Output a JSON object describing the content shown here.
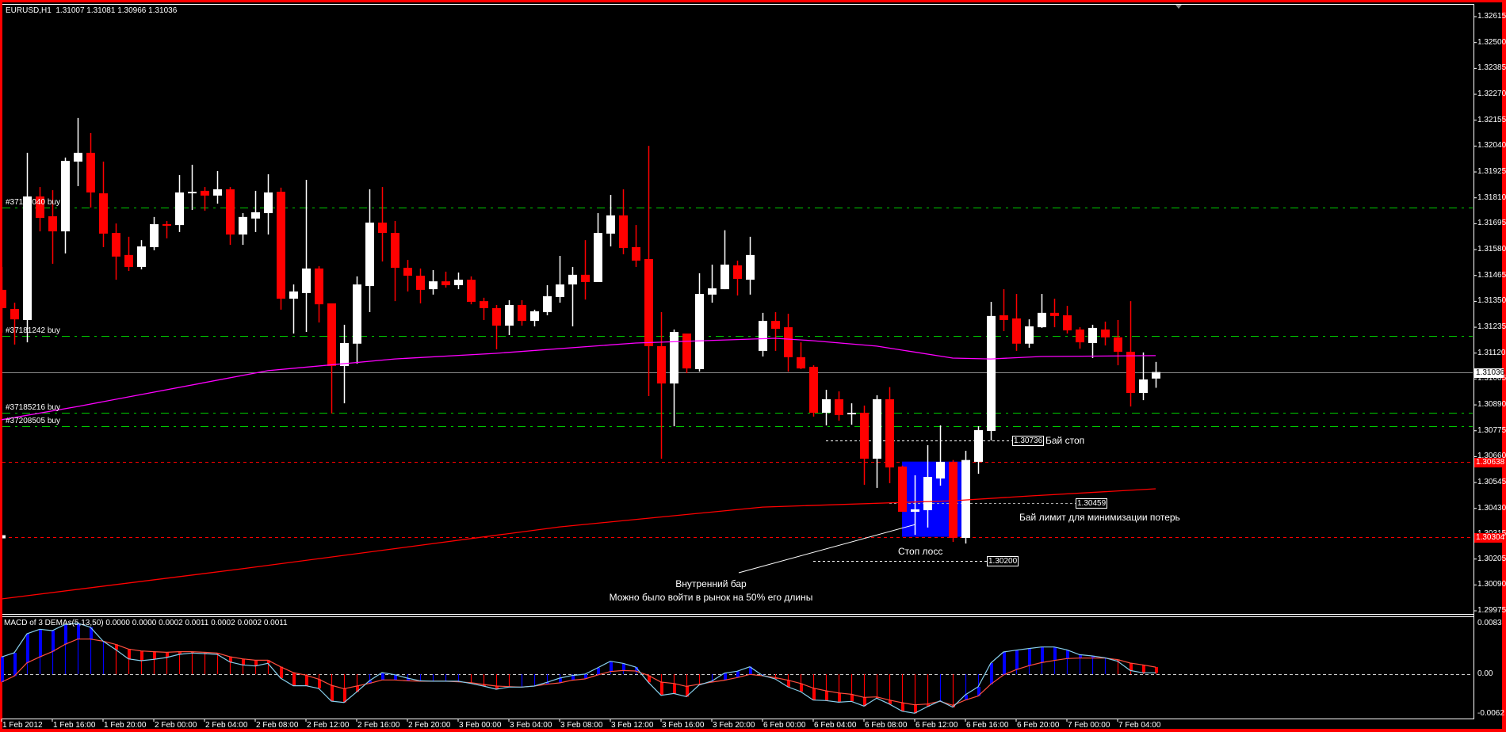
{
  "header": {
    "symbol": "EURUSD,H1",
    "ohlc": "1.31007 1.31081 1.30966 1.31036"
  },
  "colors": {
    "bull": "#ffffff",
    "bear": "#ff0000",
    "ma_fast": "#ff00ff",
    "ma_slow": "#ff0000",
    "grid_line": "#00cc00",
    "macd_main": "#87ceeb",
    "macd_signal": "#ff4f3f",
    "hist_up": "#0000ff",
    "hist_down": "#ff0000",
    "box": "#0000ff",
    "border": "#ff0000"
  },
  "orders": [
    {
      "label": "#37174040 buy",
      "price": 1.31767
    },
    {
      "label": "#37181242 buy",
      "price": 1.31196
    },
    {
      "label": "#37185216 buy",
      "price": 1.30855
    },
    {
      "label": "#37208505 buy",
      "price": 1.30795
    }
  ],
  "levels": {
    "upper": "1.30638",
    "lower": "1.30304",
    "current": "1.31036"
  },
  "annotations": {
    "buy_stop_price": "1.30736",
    "buy_stop_text": "Бай стоп",
    "buy_limit_price": "1.30459",
    "buy_limit_text": "Бай лимит для минимизации потерь",
    "stop_loss_price": "1.30200",
    "stop_loss_text": "Стоп лосс",
    "inside_bar_title": "Внутренний бар",
    "inside_bar_note": "Можно было войти в рынок на 50% его длины"
  },
  "macd": {
    "title": "MACD of 3 DEMAs(5,13,50) 0.0000 0.0000 0.0002 0.0011 0.0002 0.0002 0.0011",
    "axis": [
      "0.0083",
      "0.00",
      "-0.0062"
    ]
  },
  "chart_data": {
    "type": "candlestick",
    "title": "EURUSD,H1",
    "y_ticks": [
      "1.32615",
      "1.32500",
      "1.32385",
      "1.32270",
      "1.32155",
      "1.32040",
      "1.31925",
      "1.31810",
      "1.31695",
      "1.31580",
      "1.31465",
      "1.31350",
      "1.31235",
      "1.31120",
      "1.31005",
      "1.30890",
      "1.30775",
      "1.30660",
      "1.30545",
      "1.30430",
      "1.30315",
      "1.30205",
      "1.30090",
      "1.29975"
    ],
    "ylim": [
      1.29975,
      1.32615
    ],
    "x_labels": [
      "1 Feb 2012",
      "1 Feb 16:00",
      "1 Feb 20:00",
      "2 Feb 00:00",
      "2 Feb 04:00",
      "2 Feb 08:00",
      "2 Feb 12:00",
      "2 Feb 16:00",
      "2 Feb 20:00",
      "3 Feb 00:00",
      "3 Feb 04:00",
      "3 Feb 08:00",
      "3 Feb 12:00",
      "3 Feb 16:00",
      "3 Feb 20:00",
      "6 Feb 00:00",
      "6 Feb 04:00",
      "6 Feb 08:00",
      "6 Feb 12:00",
      "6 Feb 16:00",
      "6 Feb 20:00",
      "7 Feb 00:00",
      "7 Feb 04:00"
    ],
    "ohlc": [
      [
        1.31401,
        1.31503,
        1.31211,
        1.3132
      ],
      [
        1.31316,
        1.31344,
        1.31158,
        1.3127
      ],
      [
        1.31267,
        1.3201,
        1.31168,
        1.31816
      ],
      [
        1.31816,
        1.31858,
        1.31661,
        1.31721
      ],
      [
        1.31728,
        1.31844,
        1.31517,
        1.31661
      ],
      [
        1.31661,
        1.31989,
        1.31563,
        1.31974
      ],
      [
        1.31971,
        1.32165,
        1.31862,
        1.3201
      ],
      [
        1.3201,
        1.32098,
        1.31767,
        1.31834
      ],
      [
        1.3183,
        1.31971,
        1.31591,
        1.31651
      ],
      [
        1.31654,
        1.31696,
        1.31446,
        1.31549
      ],
      [
        1.31556,
        1.31637,
        1.31485,
        1.31503
      ],
      [
        1.31503,
        1.31622,
        1.31492,
        1.31594
      ],
      [
        1.31591,
        1.31725,
        1.31577,
        1.31693
      ],
      [
        1.31693,
        1.31707,
        1.3163,
        1.31689
      ],
      [
        1.31689,
        1.31911,
        1.31658,
        1.31834
      ],
      [
        1.3183,
        1.31957,
        1.31756,
        1.31837
      ],
      [
        1.31841,
        1.31858,
        1.31753,
        1.3182
      ],
      [
        1.3182,
        1.31929,
        1.31784,
        1.31848
      ],
      [
        1.31848,
        1.31858,
        1.31601,
        1.31647
      ],
      [
        1.31647,
        1.31742,
        1.31601,
        1.31725
      ],
      [
        1.31718,
        1.31841,
        1.31658,
        1.31746
      ],
      [
        1.31742,
        1.31915,
        1.31647,
        1.31834
      ],
      [
        1.31837,
        1.31855,
        1.31313,
        1.31362
      ],
      [
        1.31362,
        1.31425,
        1.31207,
        1.31394
      ],
      [
        1.31387,
        1.3189,
        1.31214,
        1.31496
      ],
      [
        1.31496,
        1.31506,
        1.31256,
        1.31337
      ],
      [
        1.31341,
        1.31341,
        1.30852,
        1.31063
      ],
      [
        1.31063,
        1.31246,
        1.30897,
        1.31165
      ],
      [
        1.31162,
        1.31461,
        1.31073,
        1.31425
      ],
      [
        1.31418,
        1.31848,
        1.31302,
        1.317
      ],
      [
        1.317,
        1.31858,
        1.31527,
        1.31654
      ],
      [
        1.31654,
        1.31707,
        1.31351,
        1.31499
      ],
      [
        1.31499,
        1.31534,
        1.31394,
        1.31464
      ],
      [
        1.31464,
        1.31496,
        1.31341,
        1.31401
      ],
      [
        1.31404,
        1.31489,
        1.3138,
        1.31439
      ],
      [
        1.31439,
        1.31482,
        1.31411,
        1.31422
      ],
      [
        1.31422,
        1.31478,
        1.31404,
        1.31446
      ],
      [
        1.31446,
        1.31461,
        1.31337,
        1.31348
      ],
      [
        1.31351,
        1.31366,
        1.31267,
        1.3132
      ],
      [
        1.3132,
        1.31334,
        1.31137,
        1.31242
      ],
      [
        1.31242,
        1.31355,
        1.312,
        1.31334
      ],
      [
        1.31334,
        1.31355,
        1.31242,
        1.31263
      ],
      [
        1.31263,
        1.31313,
        1.31239,
        1.31306
      ],
      [
        1.31302,
        1.31422,
        1.31288,
        1.31373
      ],
      [
        1.31369,
        1.31552,
        1.31344,
        1.31425
      ],
      [
        1.31425,
        1.31503,
        1.31239,
        1.31468
      ],
      [
        1.31468,
        1.31622,
        1.31358,
        1.31436
      ],
      [
        1.31436,
        1.31742,
        1.31436,
        1.31654
      ],
      [
        1.31651,
        1.31823,
        1.31594,
        1.31732
      ],
      [
        1.31732,
        1.31848,
        1.31559,
        1.31587
      ],
      [
        1.31591,
        1.31689,
        1.31503,
        1.31531
      ],
      [
        1.31538,
        1.32041,
        1.30929,
        1.31151
      ],
      [
        1.31151,
        1.31302,
        1.30651,
        1.30985
      ],
      [
        1.30985,
        1.31225,
        1.30795,
        1.31214
      ],
      [
        1.31207,
        1.31207,
        1.31031,
        1.31052
      ],
      [
        1.31049,
        1.31475,
        1.31038,
        1.31383
      ],
      [
        1.3138,
        1.31513,
        1.31344,
        1.31408
      ],
      [
        1.31404,
        1.31666,
        1.31404,
        1.31513
      ],
      [
        1.3151,
        1.31531,
        1.31376,
        1.3145
      ],
      [
        1.31446,
        1.31637,
        1.3138,
        1.31556
      ],
      [
        1.3113,
        1.31299,
        1.31105,
        1.31263
      ],
      [
        1.31263,
        1.31302,
        1.3113,
        1.31228
      ],
      [
        1.31235,
        1.31295,
        1.31038,
        1.31102
      ],
      [
        1.31102,
        1.31168,
        1.31049,
        1.31052
      ],
      [
        1.31059,
        1.31066,
        1.30838,
        1.30855
      ],
      [
        1.30855,
        1.30957,
        1.30799,
        1.30915
      ],
      [
        1.30915,
        1.3095,
        1.3082,
        1.30845
      ],
      [
        1.30848,
        1.30897,
        1.30802,
        1.30855
      ],
      [
        1.30855,
        1.30887,
        1.30535,
        1.30651
      ],
      [
        1.30651,
        1.30933,
        1.30521,
        1.30915
      ],
      [
        1.30915,
        1.30969,
        1.30542,
        1.30612
      ],
      [
        1.30616,
        1.3062,
        1.30415,
        1.30415
      ],
      [
        1.30415,
        1.30577,
        1.30313,
        1.30426
      ],
      [
        1.30422,
        1.30711,
        1.30345,
        1.3057
      ],
      [
        1.30563,
        1.30799,
        1.30531,
        1.30637
      ],
      [
        1.30637,
        1.30645,
        1.30281,
        1.30299
      ],
      [
        1.30299,
        1.30686,
        1.30274,
        1.30645
      ],
      [
        1.30637,
        1.30795,
        1.30584,
        1.30778
      ],
      [
        1.30774,
        1.31348,
        1.30732,
        1.31285
      ],
      [
        1.31288,
        1.31404,
        1.31218,
        1.31267
      ],
      [
        1.31274,
        1.31383,
        1.3113,
        1.31162
      ],
      [
        1.31162,
        1.3127,
        1.31144,
        1.31239
      ],
      [
        1.31235,
        1.31383,
        1.31232,
        1.31299
      ],
      [
        1.31299,
        1.31362,
        1.31235,
        1.31285
      ],
      [
        1.31288,
        1.3133,
        1.31207,
        1.31221
      ],
      [
        1.31225,
        1.31235,
        1.3114,
        1.31168
      ],
      [
        1.31165,
        1.31246,
        1.31098,
        1.31232
      ],
      [
        1.31225,
        1.3126,
        1.31154,
        1.3119
      ],
      [
        1.3119,
        1.31267,
        1.31066,
        1.31126
      ],
      [
        1.31126,
        1.31351,
        1.30883,
        1.30943
      ],
      [
        1.30943,
        1.31123,
        1.30911,
        1.31003
      ],
      [
        1.31007,
        1.31081,
        1.30966,
        1.31036
      ]
    ],
    "ma_fast": [
      [
        0,
        1.30824
      ],
      [
        6,
        1.30883
      ],
      [
        21,
        1.31042
      ],
      [
        31,
        1.31094
      ],
      [
        39,
        1.31119
      ],
      [
        50,
        1.31165
      ],
      [
        61,
        1.31186
      ],
      [
        64,
        1.31175
      ],
      [
        69,
        1.31151
      ],
      [
        75,
        1.31098
      ],
      [
        78,
        1.31094
      ],
      [
        82,
        1.31105
      ],
      [
        91,
        1.31109
      ]
    ],
    "ma_slow": [
      [
        0,
        1.30028
      ],
      [
        19,
        1.30162
      ],
      [
        44,
        1.30348
      ],
      [
        60,
        1.30436
      ],
      [
        75,
        1.30464
      ],
      [
        81,
        1.30485
      ],
      [
        91,
        1.30517
      ]
    ],
    "inside_bar_box": {
      "from_bar": 71,
      "to_bar": 76,
      "high": 1.30638,
      "low": 1.30304
    },
    "macd_main": [
      0.00267,
      0.00332,
      0.00627,
      0.00697,
      0.00677,
      0.00771,
      0.00791,
      0.0073,
      0.00513,
      0.00381,
      0.00238,
      0.00209,
      0.0023,
      0.00258,
      0.00308,
      0.00328,
      0.0032,
      0.00308,
      0.00189,
      0.00144,
      0.00127,
      0.00168,
      -0.00062,
      -0.0018,
      -0.0018,
      -0.00221,
      -0.00418,
      -0.00439,
      -0.00275,
      -0.00103,
      0.00025,
      -8e-05,
      -0.00062,
      -0.00103,
      -0.0011,
      -0.0011,
      -0.0011,
      -0.00144,
      -0.00185,
      -0.00234,
      -0.002,
      -0.002,
      -0.00185,
      -0.00127,
      -0.00062,
      -0.0002,
      0,
      0.00098,
      0.002,
      0.00168,
      0.00111,
      -0.00127,
      -0.00328,
      -0.003,
      -0.00349,
      -0.00168,
      -0.00107,
      0.00016,
      0.00045,
      0.00115,
      -0.0002,
      -0.00074,
      -0.00197,
      -0.00271,
      -0.00402,
      -0.0041,
      -0.00435,
      -0.00422,
      -0.00496,
      -0.00373,
      -0.00464,
      -0.00574,
      -0.00607,
      -0.00504,
      -0.00414,
      -0.00513,
      -0.0032,
      -0.00197,
      0.00172,
      0.00344,
      0.00373,
      0.00398,
      0.00422,
      0.00422,
      0.00377,
      0.00303,
      0.00283,
      0.00254,
      0.00201,
      0.00057,
      0.00021,
      0.0002
    ],
    "macd_signal": [
      -0.00123,
      -0.00029,
      0.00176,
      0.00267,
      0.00349,
      0.00463,
      0.00545,
      0.00545,
      0.00513,
      0.00463,
      0.0039,
      0.00361,
      0.00349,
      0.0034,
      0.00349,
      0.00349,
      0.0034,
      0.00328,
      0.00271,
      0.00238,
      0.00217,
      0.00217,
      0.00115,
      0.00025,
      -0.00016,
      -0.00078,
      -0.00172,
      -0.00226,
      -0.00185,
      -0.00144,
      -0.0009,
      -0.0009,
      -0.00103,
      -0.0011,
      -0.0011,
      -0.0011,
      -0.00119,
      -0.00131,
      -0.0016,
      -0.00185,
      -0.00193,
      -0.00201,
      -0.00185,
      -0.00156,
      -0.00135,
      -0.00094,
      -0.00074,
      -0.00012,
      0.00041,
      0.00057,
      0.00049,
      -0.0002,
      -0.00123,
      -0.00144,
      -0.00189,
      -0.00156,
      -0.00123,
      -0.00094,
      -0.00053,
      -4e-05,
      -0.00025,
      -0.00053,
      -0.00094,
      -0.00144,
      -0.00217,
      -0.00258,
      -0.00291,
      -0.00312,
      -0.00361,
      -0.00353,
      -0.00402,
      -0.00443,
      -0.00476,
      -0.00464,
      -0.00422,
      -0.00484,
      -0.00402,
      -0.0034,
      -0.00156,
      -0.00012,
      0.0007,
      0.00131,
      0.0018,
      0.00213,
      0.00242,
      0.0025,
      0.0025,
      0.0025,
      0.00226,
      0.00172,
      0.00144,
      0.0011
    ]
  }
}
